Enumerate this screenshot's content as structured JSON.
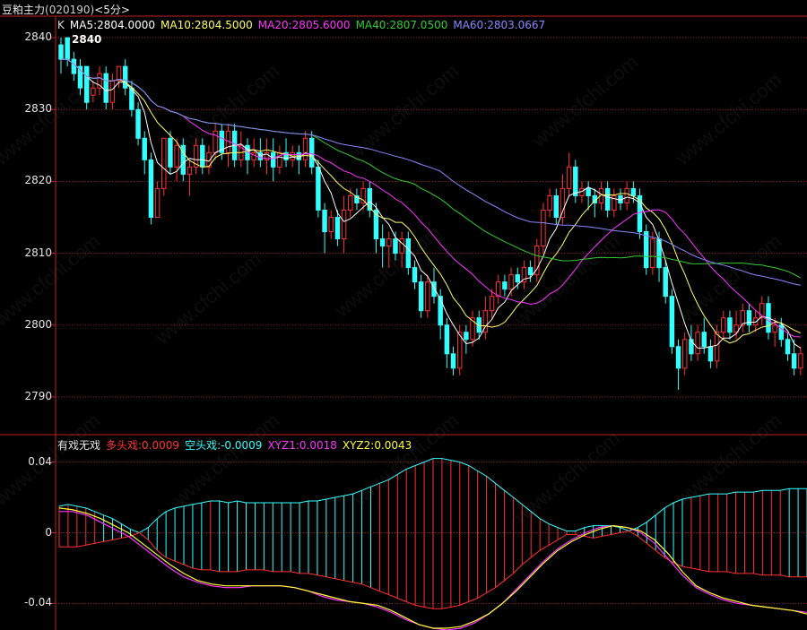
{
  "window": {
    "title": "豆粕主力",
    "code": "(020190)",
    "period": "<5分>"
  },
  "upper_legend": {
    "k_label": "K",
    "items": [
      {
        "text": "MA5:2804.0000",
        "color": "#ffffff"
      },
      {
        "text": "MA10:2804.5000",
        "color": "#ffff66"
      },
      {
        "text": "MA20:2805.6000",
        "color": "#ff33ff"
      },
      {
        "text": "MA40:2807.0500",
        "color": "#33cc33"
      },
      {
        "text": "MA60:2803.0667",
        "color": "#8888ff"
      }
    ],
    "high_label": "2840"
  },
  "lower_legend": {
    "items": [
      {
        "text": "有戏无戏",
        "color": "#e6e6e6"
      },
      {
        "text": "多头戏:0.0009",
        "color": "#ff3333"
      },
      {
        "text": "空头戏:-0.0009",
        "color": "#33ffff"
      },
      {
        "text": "XYZ1:0.0018",
        "color": "#ff33ff"
      },
      {
        "text": "XYZ2:0.0043",
        "color": "#ffff33"
      }
    ]
  },
  "watermark": "www.cfchi.com",
  "colors": {
    "up": "#ff3030",
    "down": "#33ffff",
    "grid": "#a01818",
    "axis": "#c02020"
  },
  "chart_data": [
    {
      "type": "candlestick",
      "ylim": [
        2785,
        2843
      ],
      "yticks": [
        "2840",
        "2830",
        "2820",
        "2810",
        "2800",
        "2790"
      ],
      "grid": true,
      "series_lines": [
        "MA5",
        "MA10",
        "MA20",
        "MA40",
        "MA60"
      ],
      "candles": [
        [
          2839,
          2837,
          2840,
          2835
        ],
        [
          2840,
          2837,
          2840,
          2836
        ],
        [
          2837,
          2835,
          2838,
          2834
        ],
        [
          2836,
          2833,
          2837,
          2832
        ],
        [
          2836,
          2831,
          2836,
          2830
        ],
        [
          2832,
          2833,
          2834,
          2831
        ],
        [
          2833,
          2835,
          2836,
          2832
        ],
        [
          2835,
          2831,
          2836,
          2830
        ],
        [
          2831,
          2834,
          2835,
          2830
        ],
        [
          2834,
          2836,
          2836,
          2833
        ],
        [
          2836,
          2833,
          2837,
          2832
        ],
        [
          2833,
          2830,
          2834,
          2829
        ],
        [
          2830,
          2826,
          2831,
          2825
        ],
        [
          2826,
          2823,
          2827,
          2821
        ],
        [
          2823,
          2815,
          2824,
          2814
        ],
        [
          2815,
          2819,
          2820,
          2815
        ],
        [
          2819,
          2826,
          2826,
          2818
        ],
        [
          2826,
          2822,
          2827,
          2821
        ],
        [
          2822,
          2825,
          2826,
          2820
        ],
        [
          2825,
          2821,
          2826,
          2820
        ],
        [
          2821,
          2822,
          2823,
          2818
        ],
        [
          2822,
          2825,
          2826,
          2821
        ],
        [
          2825,
          2822,
          2826,
          2821
        ],
        [
          2822,
          2824,
          2825,
          2821
        ],
        [
          2824,
          2827,
          2828,
          2823
        ],
        [
          2827,
          2824,
          2828,
          2823
        ],
        [
          2824,
          2827,
          2828,
          2822
        ],
        [
          2827,
          2823,
          2828,
          2822
        ],
        [
          2823,
          2825,
          2827,
          2822
        ],
        [
          2825,
          2823,
          2826,
          2821
        ],
        [
          2823,
          2824,
          2826,
          2822
        ],
        [
          2824,
          2823,
          2826,
          2822
        ],
        [
          2823,
          2824,
          2826,
          2821
        ],
        [
          2824,
          2822,
          2826,
          2820
        ],
        [
          2822,
          2824,
          2825,
          2821
        ],
        [
          2824,
          2823,
          2826,
          2822
        ],
        [
          2823,
          2824,
          2825,
          2822
        ],
        [
          2824,
          2823,
          2825,
          2821
        ],
        [
          2823,
          2826,
          2827,
          2822
        ],
        [
          2826,
          2822,
          2827,
          2821
        ],
        [
          2822,
          2816,
          2823,
          2815
        ],
        [
          2816,
          2813,
          2817,
          2810
        ],
        [
          2813,
          2815,
          2816,
          2812
        ],
        [
          2815,
          2812,
          2816,
          2811
        ],
        [
          2812,
          2816,
          2818,
          2810
        ],
        [
          2816,
          2818,
          2819,
          2815
        ],
        [
          2818,
          2817,
          2819,
          2816
        ],
        [
          2817,
          2819,
          2820,
          2816
        ],
        [
          2819,
          2816,
          2820,
          2815
        ],
        [
          2816,
          2812,
          2817,
          2810
        ],
        [
          2812,
          2811,
          2814,
          2808
        ],
        [
          2811,
          2812,
          2813,
          2808
        ],
        [
          2812,
          2810,
          2813,
          2809
        ],
        [
          2810,
          2812,
          2813,
          2808
        ],
        [
          2812,
          2808,
          2813,
          2807
        ],
        [
          2808,
          2806,
          2809,
          2805
        ],
        [
          2806,
          2802,
          2807,
          2801
        ],
        [
          2802,
          2806,
          2807,
          2801
        ],
        [
          2806,
          2804,
          2808,
          2803
        ],
        [
          2804,
          2800,
          2805,
          2798
        ],
        [
          2800,
          2796,
          2801,
          2794
        ],
        [
          2796,
          2794,
          2797,
          2793
        ],
        [
          2794,
          2799,
          2800,
          2793
        ],
        [
          2799,
          2798,
          2800,
          2796
        ],
        [
          2798,
          2801,
          2802,
          2797
        ],
        [
          2801,
          2799,
          2802,
          2798
        ],
        [
          2799,
          2802,
          2804,
          2798
        ],
        [
          2802,
          2804,
          2805,
          2801
        ],
        [
          2804,
          2806,
          2807,
          2803
        ],
        [
          2806,
          2805,
          2807,
          2804
        ],
        [
          2805,
          2807,
          2808,
          2804
        ],
        [
          2807,
          2806,
          2808,
          2805
        ],
        [
          2806,
          2808,
          2809,
          2805
        ],
        [
          2808,
          2807,
          2809,
          2806
        ],
        [
          2807,
          2811,
          2812,
          2806
        ],
        [
          2811,
          2816,
          2817,
          2810
        ],
        [
          2816,
          2818,
          2819,
          2815
        ],
        [
          2818,
          2815,
          2819,
          2814
        ],
        [
          2815,
          2819,
          2821,
          2814
        ],
        [
          2819,
          2822,
          2824,
          2818
        ],
        [
          2822,
          2818,
          2823,
          2817
        ],
        [
          2818,
          2819,
          2820,
          2817
        ],
        [
          2819,
          2818,
          2820,
          2816
        ],
        [
          2818,
          2817,
          2819,
          2815
        ],
        [
          2817,
          2819,
          2820,
          2816
        ],
        [
          2819,
          2816,
          2820,
          2815
        ],
        [
          2816,
          2818,
          2819,
          2815
        ],
        [
          2818,
          2817,
          2819,
          2816
        ],
        [
          2817,
          2819,
          2820,
          2816
        ],
        [
          2819,
          2818,
          2820,
          2817
        ],
        [
          2818,
          2813,
          2819,
          2812
        ],
        [
          2813,
          2808,
          2814,
          2807
        ],
        [
          2808,
          2812,
          2813,
          2807
        ],
        [
          2812,
          2808,
          2813,
          2806
        ],
        [
          2808,
          2804,
          2809,
          2803
        ],
        [
          2804,
          2797,
          2805,
          2796
        ],
        [
          2797,
          2794,
          2798,
          2791
        ],
        [
          2794,
          2798,
          2799,
          2793
        ],
        [
          2798,
          2796,
          2800,
          2795
        ],
        [
          2796,
          2799,
          2800,
          2795
        ],
        [
          2799,
          2797,
          2801,
          2796
        ],
        [
          2797,
          2795,
          2798,
          2794
        ],
        [
          2795,
          2799,
          2800,
          2794
        ],
        [
          2799,
          2801,
          2802,
          2798
        ],
        [
          2801,
          2799,
          2802,
          2798
        ],
        [
          2799,
          2800,
          2802,
          2798
        ],
        [
          2800,
          2802,
          2803,
          2799
        ],
        [
          2802,
          2800,
          2803,
          2799
        ],
        [
          2800,
          2801,
          2802,
          2799
        ],
        [
          2801,
          2803,
          2804,
          2800
        ],
        [
          2803,
          2799,
          2804,
          2798
        ],
        [
          2799,
          2800,
          2801,
          2797
        ],
        [
          2800,
          2798,
          2801,
          2797
        ],
        [
          2798,
          2796,
          2799,
          2795
        ],
        [
          2796,
          2794,
          2798,
          2793
        ],
        [
          2794,
          2796,
          2797,
          2793
        ]
      ]
    },
    {
      "type": "bar",
      "name": "有戏无戏",
      "ylim": [
        -0.055,
        0.055
      ],
      "yticks": [
        "0.04",
        "0",
        "-0.04"
      ],
      "grid": true,
      "series": [
        {
          "name": "XYZ1",
          "color": "#ff33ff"
        },
        {
          "name": "XYZ2",
          "color": "#ffff33"
        }
      ],
      "envelope": [
        [
          -0.008,
          0.015
        ],
        [
          -0.008,
          0.016
        ],
        [
          -0.008,
          0.015
        ],
        [
          -0.007,
          0.014
        ],
        [
          -0.006,
          0.012
        ],
        [
          -0.005,
          0.01
        ],
        [
          -0.004,
          0.008
        ],
        [
          -0.003,
          0.005
        ],
        [
          -0.002,
          0.002
        ],
        [
          0.0,
          0.0
        ],
        [
          0.003,
          -0.004
        ],
        [
          0.008,
          -0.01
        ],
        [
          0.012,
          -0.014
        ],
        [
          0.014,
          -0.016
        ],
        [
          0.015,
          -0.018
        ],
        [
          0.016,
          -0.02
        ],
        [
          0.017,
          -0.021
        ],
        [
          0.018,
          -0.021
        ],
        [
          0.018,
          -0.022
        ],
        [
          0.017,
          -0.022
        ],
        [
          0.018,
          -0.022
        ],
        [
          0.017,
          -0.021
        ],
        [
          0.017,
          -0.021
        ],
        [
          0.017,
          -0.021
        ],
        [
          0.017,
          -0.022
        ],
        [
          0.017,
          -0.022
        ],
        [
          0.017,
          -0.022
        ],
        [
          0.017,
          -0.023
        ],
        [
          0.018,
          -0.023
        ],
        [
          0.018,
          -0.024
        ],
        [
          0.019,
          -0.025
        ],
        [
          0.02,
          -0.026
        ],
        [
          0.021,
          -0.027
        ],
        [
          0.022,
          -0.028
        ],
        [
          0.024,
          -0.029
        ],
        [
          0.026,
          -0.031
        ],
        [
          0.028,
          -0.033
        ],
        [
          0.03,
          -0.035
        ],
        [
          0.033,
          -0.037
        ],
        [
          0.036,
          -0.039
        ],
        [
          0.038,
          -0.041
        ],
        [
          0.04,
          -0.042
        ],
        [
          0.042,
          -0.043
        ],
        [
          0.042,
          -0.043
        ],
        [
          0.041,
          -0.042
        ],
        [
          0.04,
          -0.041
        ],
        [
          0.038,
          -0.039
        ],
        [
          0.035,
          -0.037
        ],
        [
          0.032,
          -0.034
        ],
        [
          0.028,
          -0.031
        ],
        [
          0.024,
          -0.027
        ],
        [
          0.02,
          -0.023
        ],
        [
          0.016,
          -0.018
        ],
        [
          0.012,
          -0.014
        ],
        [
          0.008,
          -0.01
        ],
        [
          0.005,
          -0.007
        ],
        [
          0.003,
          -0.004
        ],
        [
          0.001,
          -0.001
        ],
        [
          -0.001,
          0.001
        ],
        [
          -0.002,
          0.003
        ],
        [
          -0.003,
          0.004
        ],
        [
          -0.002,
          0.004
        ],
        [
          -0.001,
          0.004
        ],
        [
          0.0,
          0.003
        ],
        [
          0.001,
          0.001
        ],
        [
          0.003,
          -0.002
        ],
        [
          0.006,
          -0.006
        ],
        [
          0.01,
          -0.01
        ],
        [
          0.014,
          -0.014
        ],
        [
          0.017,
          -0.017
        ],
        [
          0.019,
          -0.019
        ],
        [
          0.02,
          -0.02
        ],
        [
          0.021,
          -0.021
        ],
        [
          0.022,
          -0.022
        ],
        [
          0.022,
          -0.022
        ],
        [
          0.022,
          -0.022
        ],
        [
          0.023,
          -0.023
        ],
        [
          0.023,
          -0.023
        ],
        [
          0.023,
          -0.023
        ],
        [
          0.024,
          -0.024
        ],
        [
          0.024,
          -0.024
        ],
        [
          0.024,
          -0.024
        ],
        [
          0.025,
          -0.025
        ],
        [
          0.025,
          -0.025
        ],
        [
          0.025,
          -0.025
        ]
      ],
      "bar_colors": "rrrrrccccccccccccrccccccccccccccccccrrrrrrrrrrrrrrrrrrrrrrrccccccccccccrrrrrrrrrrrccccc",
      "xyz1": [
        0.012,
        0.012,
        0.01,
        0.006,
        0.002,
        -0.002,
        -0.008,
        -0.014,
        -0.02,
        -0.025,
        -0.028,
        -0.03,
        -0.031,
        -0.031,
        -0.03,
        -0.03,
        -0.03,
        -0.031,
        -0.033,
        -0.036,
        -0.038,
        -0.039,
        -0.04,
        -0.042,
        -0.045,
        -0.049,
        -0.052,
        -0.054,
        -0.055,
        -0.054,
        -0.051,
        -0.046,
        -0.04,
        -0.032,
        -0.024,
        -0.016,
        -0.009,
        -0.004,
        0.0,
        0.003,
        0.004,
        0.003,
        0.0,
        -0.006,
        -0.015,
        -0.024,
        -0.031,
        -0.035,
        -0.038,
        -0.04,
        -0.041,
        -0.042,
        -0.043,
        -0.044,
        -0.045
      ],
      "xyz2": [
        0.014,
        0.013,
        0.011,
        0.008,
        0.004,
        0.0,
        -0.006,
        -0.012,
        -0.018,
        -0.023,
        -0.027,
        -0.029,
        -0.03,
        -0.03,
        -0.03,
        -0.03,
        -0.03,
        -0.031,
        -0.033,
        -0.035,
        -0.037,
        -0.039,
        -0.04,
        -0.041,
        -0.044,
        -0.048,
        -0.052,
        -0.054,
        -0.054,
        -0.053,
        -0.05,
        -0.046,
        -0.04,
        -0.033,
        -0.025,
        -0.017,
        -0.01,
        -0.005,
        -0.001,
        0.002,
        0.004,
        0.003,
        0.001,
        -0.004,
        -0.012,
        -0.022,
        -0.03,
        -0.034,
        -0.037,
        -0.039,
        -0.041,
        -0.042,
        -0.043,
        -0.044,
        -0.046
      ]
    }
  ]
}
